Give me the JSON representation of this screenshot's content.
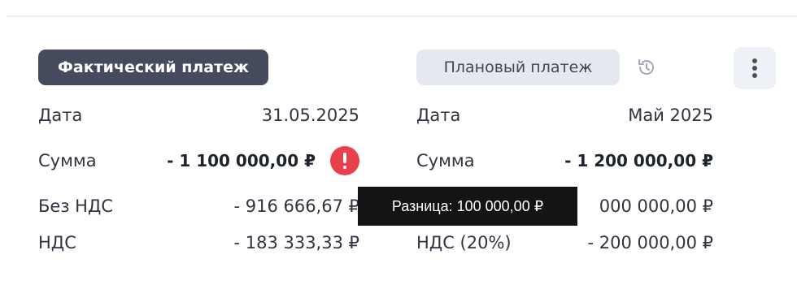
{
  "actual": {
    "chip_label": "Фактический платеж",
    "date_label": "Дата",
    "date_value": "31.05.2025",
    "sum_label": "Сумма",
    "sum_value": "- 1 100 000,00 ₽",
    "no_vat_label": "Без НДС",
    "no_vat_value": "- 916 666,67 ₽",
    "vat_label": "НДС",
    "vat_value": "- 183 333,33 ₽"
  },
  "planned": {
    "chip_label": "Плановый платеж",
    "date_label": "Дата",
    "date_value": "Май 2025",
    "sum_label": "Сумма",
    "sum_value": "- 1 200 000,00 ₽",
    "no_vat_value_partial": "000 000,00 ₽",
    "vat_label": "НДС (20%)",
    "vat_value": "- 200 000,00 ₽"
  },
  "tooltip": {
    "text": "Разница: 100 000,00 ₽"
  },
  "icons": {
    "history": "history-icon",
    "menu": "more-vertical-icon",
    "alert": "alert-icon"
  },
  "colors": {
    "actual_chip_bg": "#454a5c",
    "planned_chip_bg": "#e5e9ef",
    "alert": "#e8404d",
    "tooltip_bg": "#141414"
  }
}
